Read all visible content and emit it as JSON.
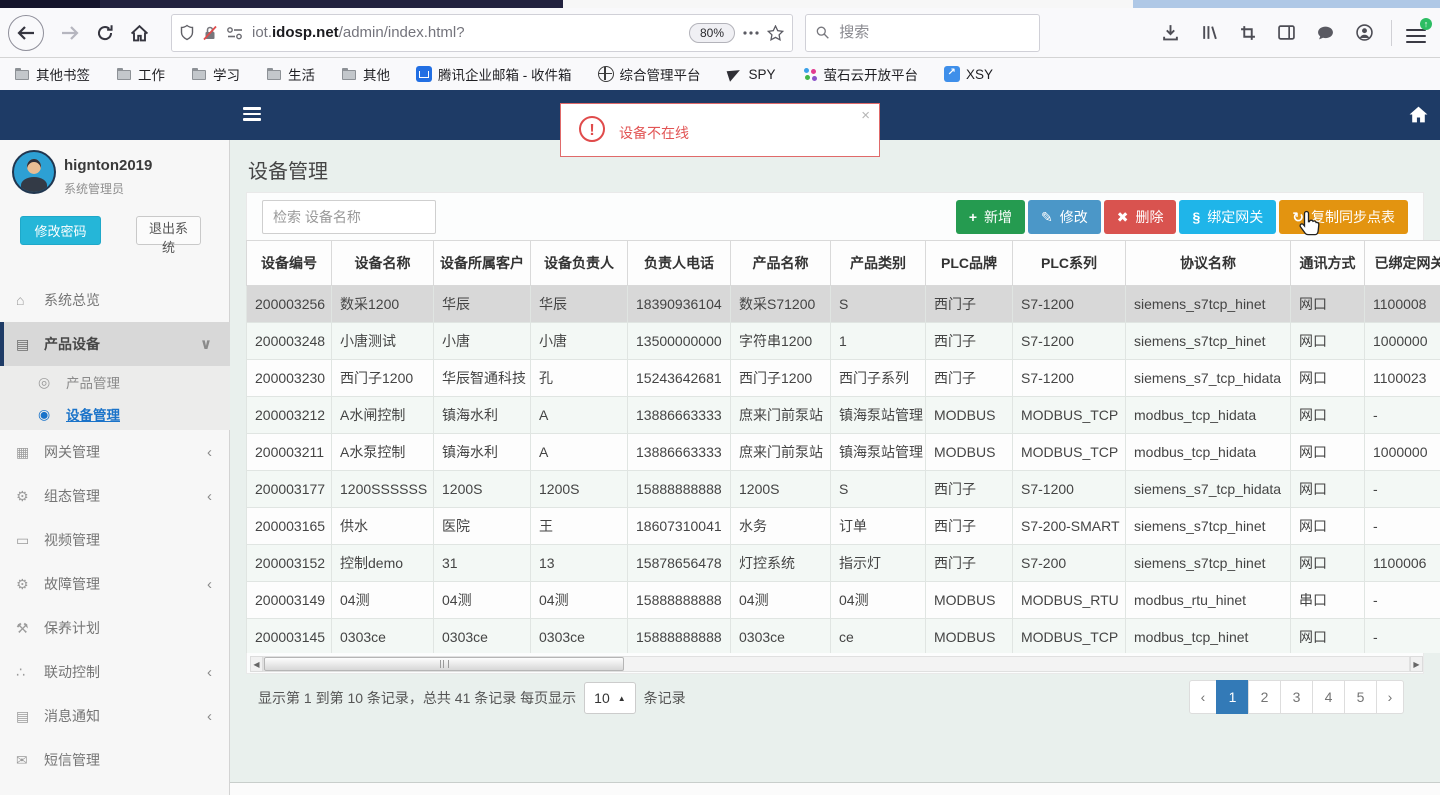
{
  "colors": {
    "navbar_navy": "#1e3b66",
    "content_bg": "#e9f0ed",
    "btn_green": "#259b50",
    "btn_blue": "#4b97c8",
    "btn_red": "#d9534f",
    "btn_cyan": "#1fb5e9",
    "btn_orange": "#e39410",
    "pagination_active_blue": "#337ab7",
    "alert_red": "#e25555",
    "link_blue": "#1a73c9",
    "change_password_cyan": "#25b6d8"
  },
  "browser": {
    "url": {
      "prefix": "iot.",
      "domain": "idosp.net",
      "path": "/admin/index.html?"
    },
    "zoom_badge": "80%",
    "search_placeholder": "搜索",
    "bookmarks": [
      {
        "label": "其他书签",
        "type": "folder"
      },
      {
        "label": "工作",
        "type": "folder"
      },
      {
        "label": "学习",
        "type": "folder"
      },
      {
        "label": "生活",
        "type": "folder"
      },
      {
        "label": "其他",
        "type": "folder"
      },
      {
        "label": "腾讯企业邮箱 - 收件箱",
        "type": "site-mail"
      },
      {
        "label": "综合管理平台",
        "type": "site-globe"
      },
      {
        "label": "SPY",
        "type": "site-plane"
      },
      {
        "label": "萤石云开放平台",
        "type": "site-dots"
      },
      {
        "label": "XSY",
        "type": "site-arrow"
      }
    ]
  },
  "alert": {
    "icon_glyph": "!",
    "text": "设备不在线",
    "close_glyph": "×"
  },
  "sidebar": {
    "username": "hignton2019",
    "role": "系统管理员",
    "change_password": "修改密码",
    "logout": "退出系统",
    "menu": [
      {
        "icon": "home-icon",
        "glyph": "⌂",
        "label": "系统总览",
        "arrow": "",
        "state": "norm"
      },
      {
        "icon": "book-icon",
        "glyph": "▤",
        "label": "产品设备",
        "arrow": "∨",
        "state": "active"
      },
      {
        "icon": "circle-dot-icon",
        "glyph": "◎",
        "label": "产品管理",
        "arrow": "",
        "state": "sub"
      },
      {
        "icon": "circle-dot-icon",
        "glyph": "◉",
        "label": "设备管理",
        "arrow": "",
        "state": "sub-active"
      },
      {
        "icon": "gateway-icon",
        "glyph": "▦",
        "label": "网关管理",
        "arrow": "‹",
        "state": "norm"
      },
      {
        "icon": "gears-icon",
        "glyph": "⚙",
        "label": "组态管理",
        "arrow": "‹",
        "state": "norm"
      },
      {
        "icon": "monitor-icon",
        "glyph": "▭",
        "label": "视频管理",
        "arrow": "",
        "state": "norm"
      },
      {
        "icon": "gears-icon",
        "glyph": "⚙",
        "label": "故障管理",
        "arrow": "‹",
        "state": "norm"
      },
      {
        "icon": "wrench-icon",
        "glyph": "⚒",
        "label": "保养计划",
        "arrow": "",
        "state": "norm"
      },
      {
        "icon": "sitemap-icon",
        "glyph": "∴",
        "label": "联动控制",
        "arrow": "‹",
        "state": "norm"
      },
      {
        "icon": "notice-icon",
        "glyph": "▤",
        "label": "消息通知",
        "arrow": "‹",
        "state": "norm"
      },
      {
        "icon": "envelope-icon",
        "glyph": "✉",
        "label": "短信管理",
        "arrow": "",
        "state": "norm"
      }
    ]
  },
  "main": {
    "title": "设备管理",
    "search_placeholder": "检索 设备名称",
    "toolbar": [
      {
        "icon": "plus-icon",
        "glyph": "+",
        "label": "新增",
        "variant": "success",
        "color": "#259b50"
      },
      {
        "icon": "pencil-icon",
        "glyph": "✎",
        "label": "修改",
        "variant": "primary",
        "color": "#4b97c8"
      },
      {
        "icon": "delete-x-icon",
        "glyph": "✖",
        "label": "删除",
        "variant": "danger",
        "color": "#d9534f"
      },
      {
        "icon": "link-icon",
        "glyph": "§",
        "label": "绑定网关",
        "variant": "cyan",
        "color": "#1fb5e9"
      },
      {
        "icon": "sync-refresh-icon",
        "glyph": "↻",
        "label": "复制同步点表",
        "variant": "warning",
        "color": "#e39410"
      }
    ],
    "table": {
      "headers": [
        "设备编号",
        "设备名称",
        "设备所属客户",
        "设备负责人",
        "负责人电话",
        "产品名称",
        "产品类别",
        "PLC品牌",
        "PLC系列",
        "协议名称",
        "通讯方式",
        "已绑定网关"
      ],
      "rows": [
        [
          "200003256",
          "数采1200",
          "华辰",
          "华辰",
          "18390936104",
          "数采S71200",
          "S",
          "西门子",
          "S7-1200",
          "siemens_s7tcp_hinet",
          "网口",
          "1100008"
        ],
        [
          "200003248",
          "小唐测试",
          "小唐",
          "小唐",
          "13500000000",
          "字符串1200",
          "1",
          "西门子",
          "S7-1200",
          "siemens_s7tcp_hinet",
          "网口",
          "1000000"
        ],
        [
          "200003230",
          "西门子1200",
          "华辰智通科技",
          "孔",
          "15243642681",
          "西门子1200",
          "西门子系列",
          "西门子",
          "S7-1200",
          "siemens_s7_tcp_hidata",
          "网口",
          "1100023"
        ],
        [
          "200003212",
          "A水闸控制",
          "镇海水利",
          "A",
          "13886663333",
          "庶来门前泵站",
          "镇海泵站管理",
          "MODBUS",
          "MODBUS_TCP",
          "modbus_tcp_hidata",
          "网口",
          "-"
        ],
        [
          "200003211",
          "A水泵控制",
          "镇海水利",
          "A",
          "13886663333",
          "庶来门前泵站",
          "镇海泵站管理",
          "MODBUS",
          "MODBUS_TCP",
          "modbus_tcp_hidata",
          "网口",
          "1000000"
        ],
        [
          "200003177",
          "1200SSSSSS",
          "1200S",
          "1200S",
          "15888888888",
          "1200S",
          "S",
          "西门子",
          "S7-1200",
          "siemens_s7_tcp_hidata",
          "网口",
          "-"
        ],
        [
          "200003165",
          "供水",
          "医院",
          "王",
          "18607310041",
          "水务",
          "订单",
          "西门子",
          "S7-200-SMART",
          "siemens_s7tcp_hinet",
          "网口",
          "-"
        ],
        [
          "200003152",
          "控制demo",
          "31",
          "13",
          "15878656478",
          "灯控系统",
          "指示灯",
          "西门子",
          "S7-200",
          "siemens_s7tcp_hinet",
          "网口",
          "1100006"
        ],
        [
          "200003149",
          "04测",
          "04测",
          "04测",
          "15888888888",
          "04测",
          "04测",
          "MODBUS",
          "MODBUS_RTU",
          "modbus_rtu_hinet",
          "串口",
          "-"
        ],
        [
          "200003145",
          "0303ce",
          "0303ce",
          "0303ce",
          "15888888888",
          "0303ce",
          "ce",
          "MODBUS",
          "MODBUS_TCP",
          "modbus_tcp_hinet",
          "网口",
          "-"
        ]
      ]
    },
    "scrollbar": {
      "left_glyph": "◀",
      "right_glyph": "▶"
    },
    "pagination": {
      "summary_prefix": "显示第 1 到第 10 条记录，总共 41 条记录 每页显示",
      "page_size": "10",
      "caret_glyph": "▲",
      "summary_suffix": "条记录",
      "prev": "‹",
      "next": "›",
      "pages": [
        "1",
        "2",
        "3",
        "4",
        "5"
      ]
    }
  }
}
